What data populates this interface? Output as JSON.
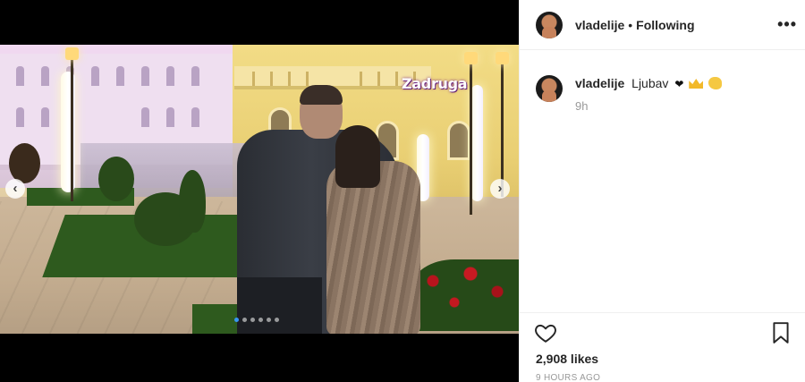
{
  "media": {
    "watermark_text": "Zadruga",
    "prev_arrow": "‹",
    "next_arrow": "›",
    "carousel_dot_count": 6,
    "carousel_active_index": 0
  },
  "header": {
    "username": "vladelije",
    "separator": "•",
    "follow_state": "Following",
    "more_icon": "•••"
  },
  "caption": {
    "username": "vladelije",
    "text": "Ljubav",
    "emojis": [
      "black-heart",
      "crown",
      "flexed-biceps"
    ],
    "heart_glyph": "❤",
    "time": "9h"
  },
  "actions": {
    "like_icon": "heart-outline-icon",
    "save_icon": "bookmark-outline-icon"
  },
  "likes": {
    "count_label": "2,908 likes"
  },
  "timestamp": "9 HOURS AGO",
  "colors": {
    "accent": "#3897f0",
    "text": "#262626",
    "muted": "#999999",
    "divider": "#efefef"
  }
}
